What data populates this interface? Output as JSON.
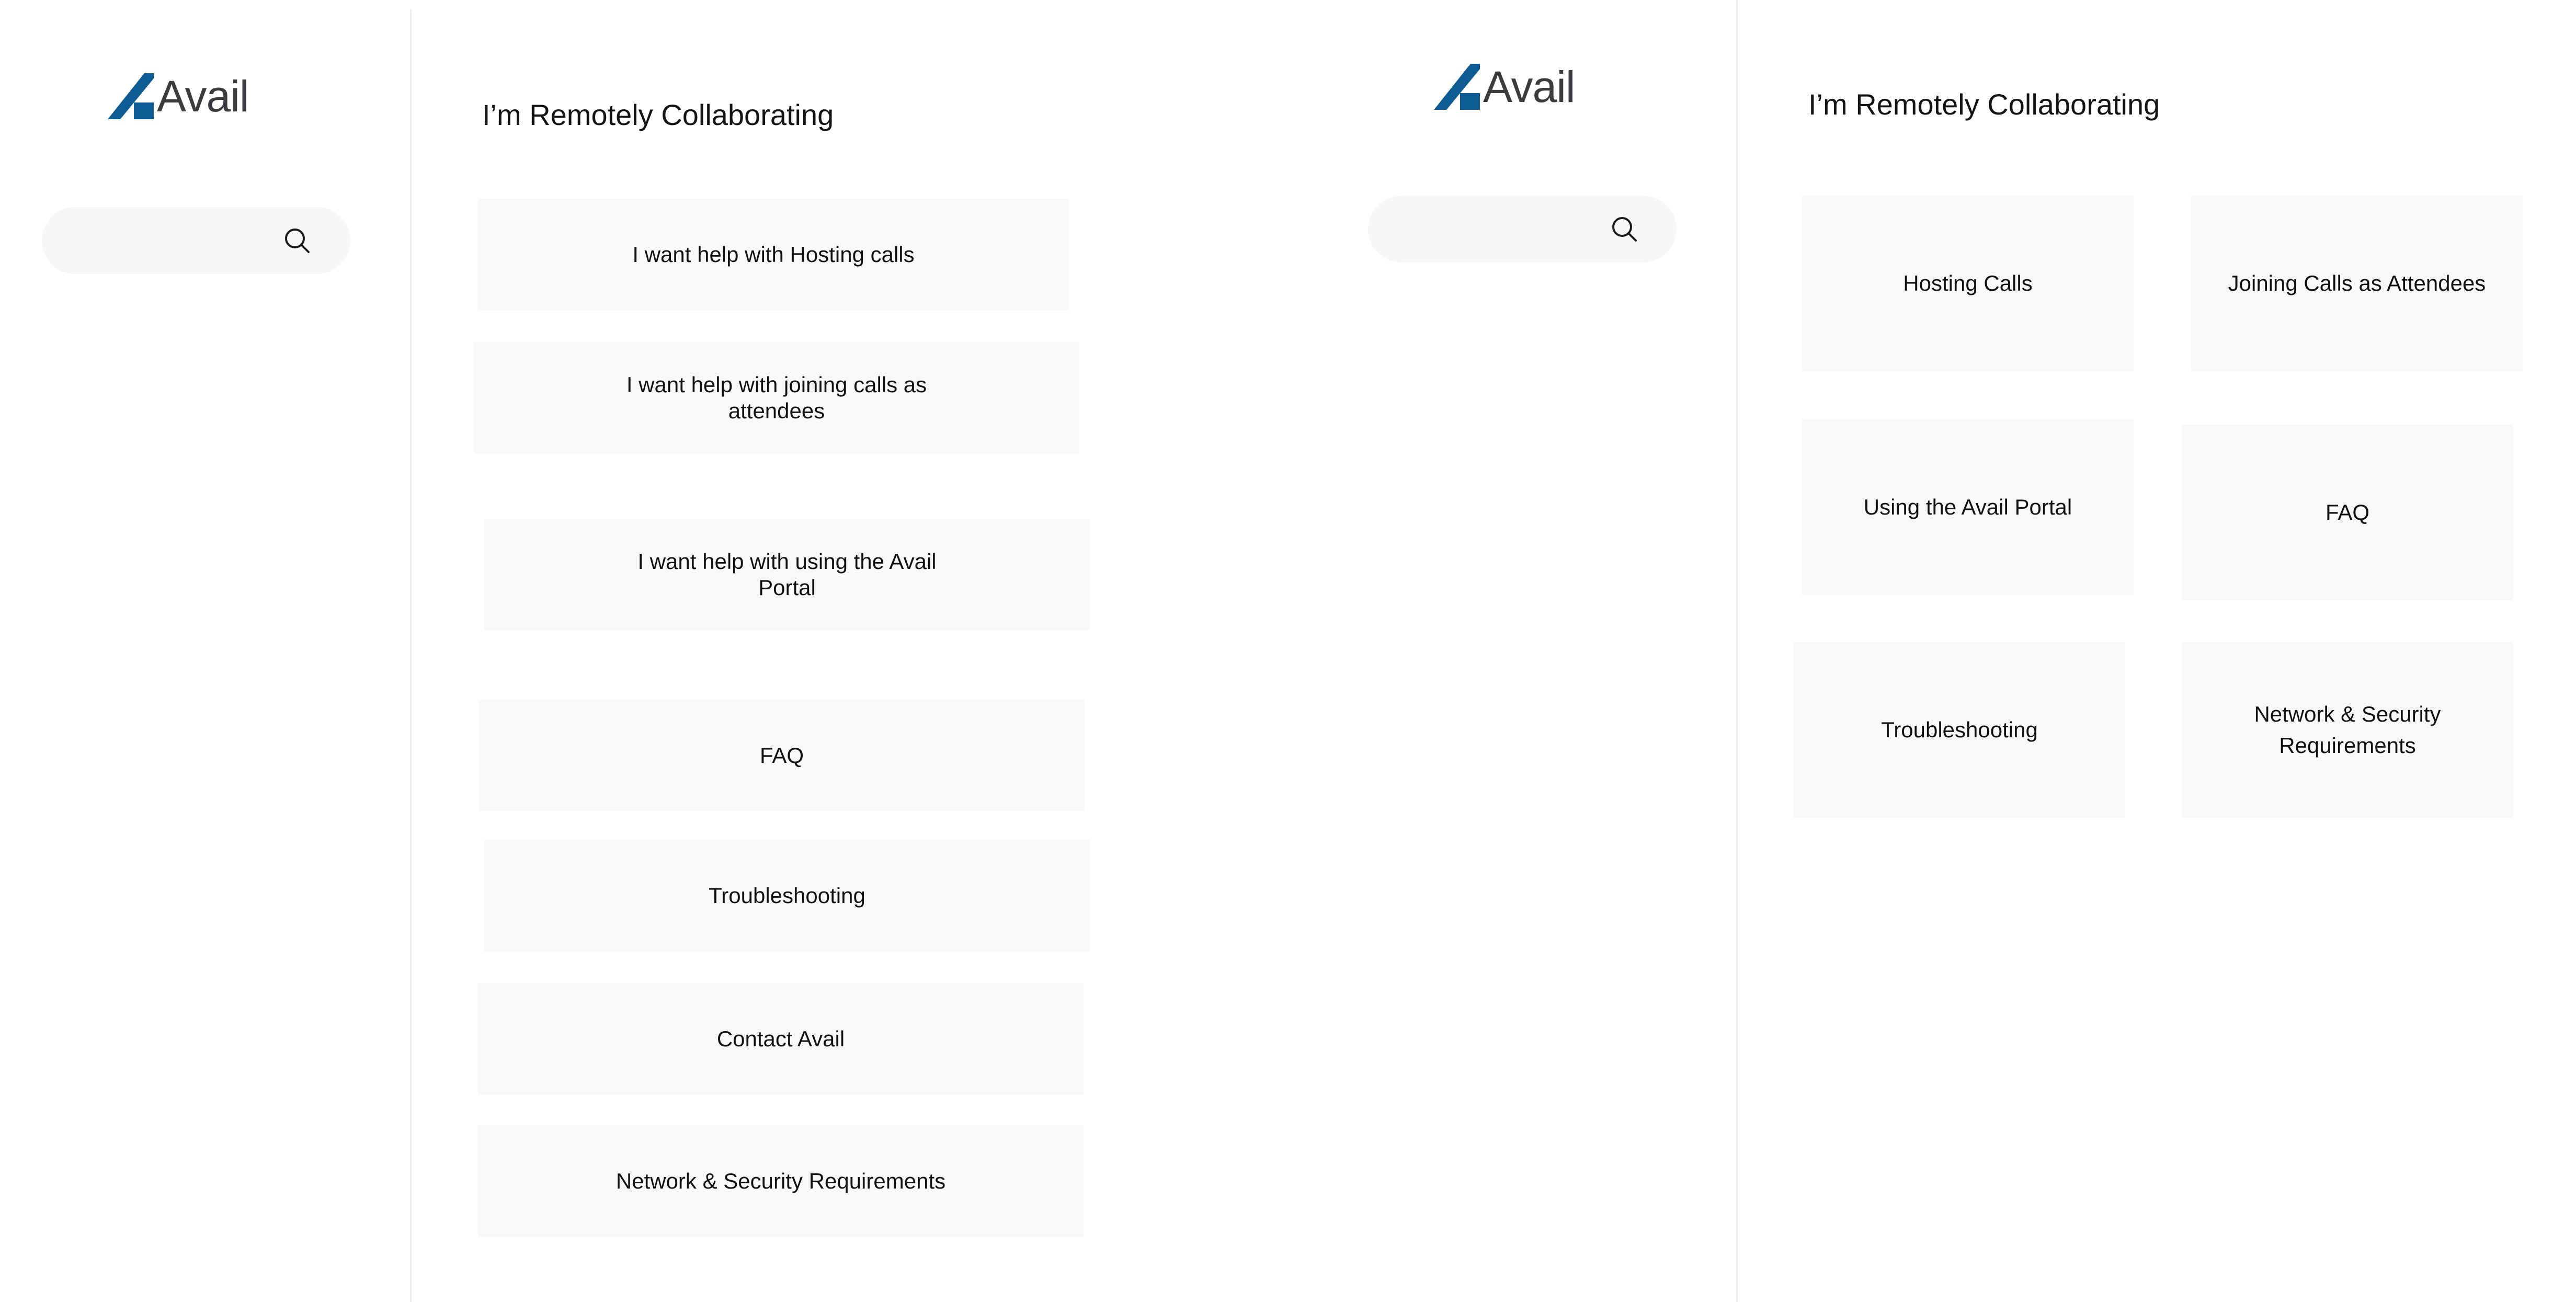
{
  "brand": {
    "name": "Avail",
    "mark_color": "#0d5c94",
    "text_color": "#3c3c3e"
  },
  "left": {
    "title": "I’m Remotely Collaborating",
    "search": {
      "placeholder": ""
    },
    "options": [
      {
        "label": "I want help with Hosting calls"
      },
      {
        "label": "I want help with joining calls as attendees"
      },
      {
        "label": "I want help with using the Avail Portal"
      },
      {
        "label": "FAQ"
      },
      {
        "label": "Troubleshooting"
      },
      {
        "label": "Contact Avail"
      },
      {
        "label": "Network & Security Requirements"
      }
    ]
  },
  "right": {
    "title": "I’m Remotely Collaborating",
    "search": {
      "placeholder": ""
    },
    "tiles": [
      {
        "label": "Hosting Calls"
      },
      {
        "label": "Joining Calls as Attendees"
      },
      {
        "label": "Using the Avail Portal"
      },
      {
        "label": "FAQ"
      },
      {
        "label": "Troubleshooting"
      },
      {
        "label": "Network & Security Requirements"
      }
    ]
  },
  "colors": {
    "card_bg": "#f8f8f8",
    "search_bg": "#f7f7f7",
    "divider": "#efefef"
  },
  "icons": {
    "search": "search-icon",
    "logo": "avail-logo-mark-icon"
  }
}
